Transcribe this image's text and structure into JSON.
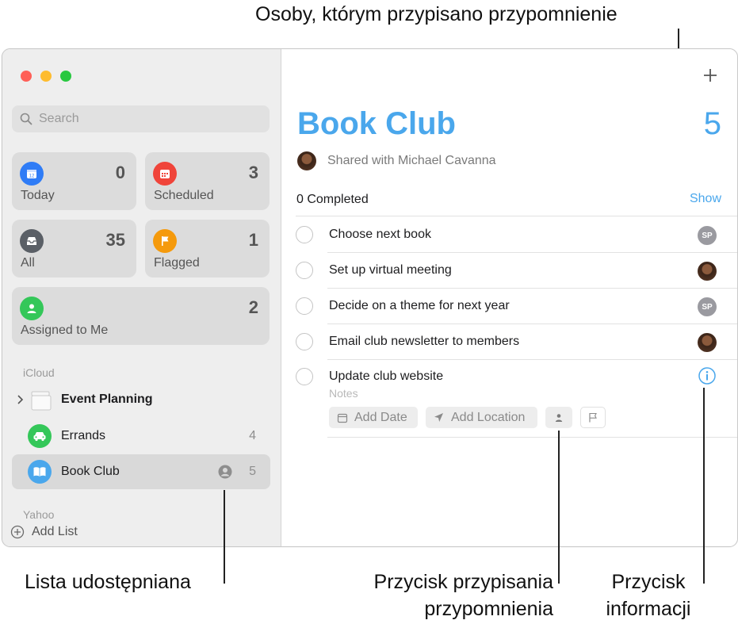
{
  "callouts": {
    "top": "Osoby, którym przypisano przypomnienie",
    "shared_list": "Lista udostępniana",
    "assign_button": "Przycisk przypisania przypomnienia",
    "info_button": "Przycisk informacji"
  },
  "sidebar": {
    "search_placeholder": "Search",
    "smart_lists": [
      {
        "label": "Today",
        "count": "0",
        "color": "#2f7cf6",
        "icon": "calendar-icon"
      },
      {
        "label": "Scheduled",
        "count": "3",
        "color": "#f0443a",
        "icon": "calendar-grid-icon"
      },
      {
        "label": "All",
        "count": "35",
        "color": "#5a5f66",
        "icon": "tray-icon"
      },
      {
        "label": "Flagged",
        "count": "1",
        "color": "#f59a0c",
        "icon": "flag-icon"
      },
      {
        "label": "Assigned to Me",
        "count": "2",
        "color": "#34c759",
        "icon": "person-icon"
      }
    ],
    "section_icloud": "iCloud",
    "lists": [
      {
        "name": "Event Planning",
        "count": "",
        "icon": "folder-icon"
      },
      {
        "name": "Errands",
        "count": "4",
        "color": "#34c759",
        "icon": "car-icon"
      },
      {
        "name": "Book Club",
        "count": "5",
        "color": "#4aa7ec",
        "icon": "book-icon",
        "selected": true
      }
    ],
    "section_yahoo": "Yahoo",
    "add_list": "Add List"
  },
  "main": {
    "title": "Book Club",
    "count": "5",
    "shared_with": "Shared with Michael Cavanna",
    "completed": "0 Completed",
    "show": "Show",
    "tasks": [
      {
        "text": "Choose next book",
        "assignee": "SP"
      },
      {
        "text": "Set up virtual meeting",
        "assignee": "photo"
      },
      {
        "text": "Decide on a theme for next year",
        "assignee": "SP"
      },
      {
        "text": "Email club newsletter to members",
        "assignee": "photo"
      },
      {
        "text": "Update club website",
        "notes": "Notes"
      }
    ],
    "chips": {
      "add_date": "Add Date",
      "add_location": "Add Location"
    },
    "accent": "#4aa7ec"
  }
}
